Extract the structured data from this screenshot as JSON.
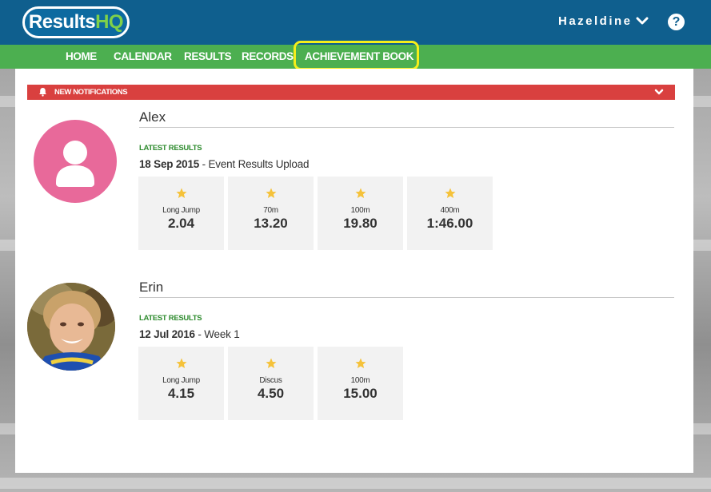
{
  "header": {
    "logo_main": "Results",
    "logo_accent": "HQ",
    "user_name": "Hazeldine",
    "help_glyph": "?"
  },
  "nav": {
    "items": [
      {
        "label": "HOME"
      },
      {
        "label": "CALENDAR"
      },
      {
        "label": "RESULTS"
      },
      {
        "label": "RECORDS"
      },
      {
        "label": "ACHIEVEMENT BOOK"
      }
    ],
    "highlighted": "ACHIEVEMENT BOOK"
  },
  "notifications": {
    "label": "NEW NOTIFICATIONS",
    "icon": "bell-icon"
  },
  "athletes": [
    {
      "name": "Alex",
      "latest_label": "LATEST RESULTS",
      "latest_date": "18 Sep 2015",
      "latest_event": " - Event Results Upload",
      "results": [
        {
          "event": "Long Jump",
          "value": "2.04"
        },
        {
          "event": "70m",
          "value": "13.20"
        },
        {
          "event": "100m",
          "value": "19.80"
        },
        {
          "event": "400m",
          "value": "1:46.00"
        }
      ]
    },
    {
      "name": "Erin",
      "latest_label": "LATEST RESULTS",
      "latest_date": "12 Jul 2016",
      "latest_event": " - Week 1",
      "results": [
        {
          "event": "Long Jump",
          "value": "4.15"
        },
        {
          "event": "Discus",
          "value": "4.50"
        },
        {
          "event": "100m",
          "value": "15.00"
        }
      ]
    }
  ],
  "colors": {
    "header_blue": "#0f5f8e",
    "nav_green": "#4caf50",
    "highlight_yellow": "#f5ee1a",
    "notification_red": "#d9403f",
    "star_gold": "#f5c23a",
    "avatar_pink": "#e8699a"
  }
}
